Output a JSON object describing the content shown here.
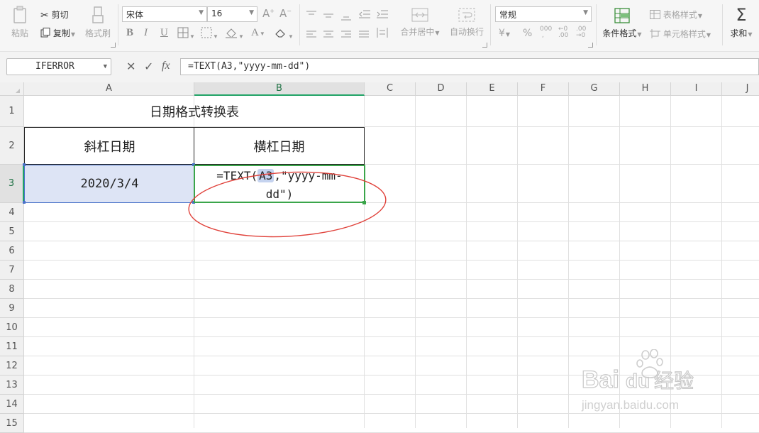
{
  "toolbar": {
    "paste_label": "粘贴",
    "cut_label": "剪切",
    "copy_label": "复制",
    "format_painter_label": "格式刷",
    "font_name": "宋体",
    "font_size": "16",
    "merge_center_label": "合并居中",
    "wrap_text_label": "自动换行",
    "number_format": "常规",
    "conditional_format_label": "条件格式",
    "table_style_label": "表格样式",
    "cell_style_label": "单元格样式",
    "sum_label": "求和"
  },
  "formula_bar": {
    "name_box": "IFERROR",
    "fx_label": "fx",
    "formula": "=TEXT(A3,\"yyyy-mm-dd\")"
  },
  "columns": [
    "A",
    "B",
    "C",
    "D",
    "E",
    "F",
    "G",
    "H",
    "I",
    "J"
  ],
  "rows": [
    "1",
    "2",
    "3",
    "4",
    "5",
    "6",
    "7",
    "8",
    "9",
    "10",
    "11",
    "12",
    "13",
    "14",
    "15"
  ],
  "sheet": {
    "title": "日期格式转换表",
    "header_a": "斜杠日期",
    "header_b": "横杠日期",
    "a3_value": "2020/3/4",
    "b3_prefix": "=TEXT(",
    "b3_ref": "A3",
    "b3_line1_rest": ",\"yyyy-mm-",
    "b3_line2": "dd\")"
  },
  "watermark": {
    "brand": "Baidu",
    "brand_cn": "经验",
    "url": "jingyan.baidu.com"
  },
  "colors": {
    "selection_green": "#3aa54a",
    "reference_blue": "#4a73c9",
    "reference_fill": "#dde4f5",
    "annotation_red": "#e0413a"
  }
}
